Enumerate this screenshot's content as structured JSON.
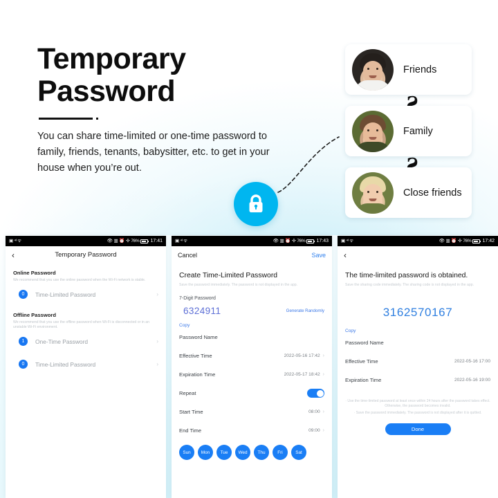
{
  "theme": {
    "accent": "#1a7ef5",
    "cyan": "#00b6f0",
    "link": "#3b78e7",
    "code_purple": "#5d6fd6",
    "code_blue": "#2f7fe0"
  },
  "hero": {
    "title_line1": "Temporary",
    "title_line2": "Password",
    "subtitle": "You can share time-limited or one-time password to family, friends, tenants, babysitter, etc. to get in your house when you’re out."
  },
  "lock_badge": {
    "icon": "lock-icon"
  },
  "contacts": [
    {
      "label": "Friends",
      "avatar": "avatar-man-dark-hair"
    },
    {
      "label": "Family",
      "avatar": "avatar-man-beard"
    },
    {
      "label": "Close friends",
      "avatar": "avatar-woman-blonde"
    }
  ],
  "chain_link_glyph": "Ƨ",
  "phone1": {
    "status": {
      "time": "17:41",
      "battery": "76%",
      "icons": "signal-wifi-bluetooth-alarm"
    },
    "back_icon": "chevron-left-icon",
    "title": "Temporary Password",
    "sections": [
      {
        "heading": "Online Password",
        "description": "We recommend that you use the online password when the Wi-Fi network is stable.",
        "items": [
          {
            "badge": "0",
            "label": "Time-Limited Password"
          }
        ]
      },
      {
        "heading": "Offline Password",
        "description": "We recommend that you use the offline password when Wi-Fi is disconnected or in an unstable Wi-Fi environment.",
        "items": [
          {
            "badge": "1",
            "label": "One-Time Password"
          },
          {
            "badge": "0",
            "label": "Time-Limited Password"
          }
        ]
      }
    ],
    "chevron": "›"
  },
  "phone2": {
    "status": {
      "time": "17:43",
      "battery": "76%",
      "icons": "signal-wifi-bluetooth-alarm"
    },
    "cancel_label": "Cancel",
    "save_label": "Save",
    "title": "Create Time-Limited Password",
    "note": "Save the password immediately. The password is not displayed in the app.",
    "password_field_label": "7-Digit Password",
    "password_value": "6324911",
    "generate_label": "Generate Randomly",
    "copy_label": "Copy",
    "rows": [
      {
        "label": "Password Name",
        "value": "",
        "chevron": false
      },
      {
        "label": "Effective Time",
        "value": "2022-05-16 17:42",
        "chevron": true
      },
      {
        "label": "Expiration Time",
        "value": "2022-05-17 18:42",
        "chevron": true
      }
    ],
    "repeat_label": "Repeat",
    "repeat_on": true,
    "time_rows": [
      {
        "label": "Start Time",
        "value": "08:00",
        "chevron": true
      },
      {
        "label": "End Time",
        "value": "09:00",
        "chevron": true
      }
    ],
    "days": [
      "Sun",
      "Mon",
      "Tue",
      "Wed",
      "Thu",
      "Fri",
      "Sat"
    ],
    "chevron": "›"
  },
  "phone3": {
    "status": {
      "time": "17:42",
      "battery": "76%",
      "icons": "signal-wifi-bluetooth-alarm"
    },
    "back_icon": "chevron-left-icon",
    "title": "The time-limited password is obtained.",
    "note": "Save the sharing code immediately. The sharing code is not displayed in the app.",
    "code": "3162570167",
    "copy_label": "Copy",
    "rows": [
      {
        "label": "Password Name",
        "value": ""
      },
      {
        "label": "Effective Time",
        "value": "2022-05-16 17:00"
      },
      {
        "label": "Expiration Time",
        "value": "2022-05-16 19:00"
      }
    ],
    "legal_line1": "· Use the time-limited password at least once within 24 hours after the password takes effect. Otherwise, the password becomes invalid.",
    "legal_line2": "· Save the password immediately. The password is not displayed after it is quitted.",
    "done_label": "Done"
  }
}
